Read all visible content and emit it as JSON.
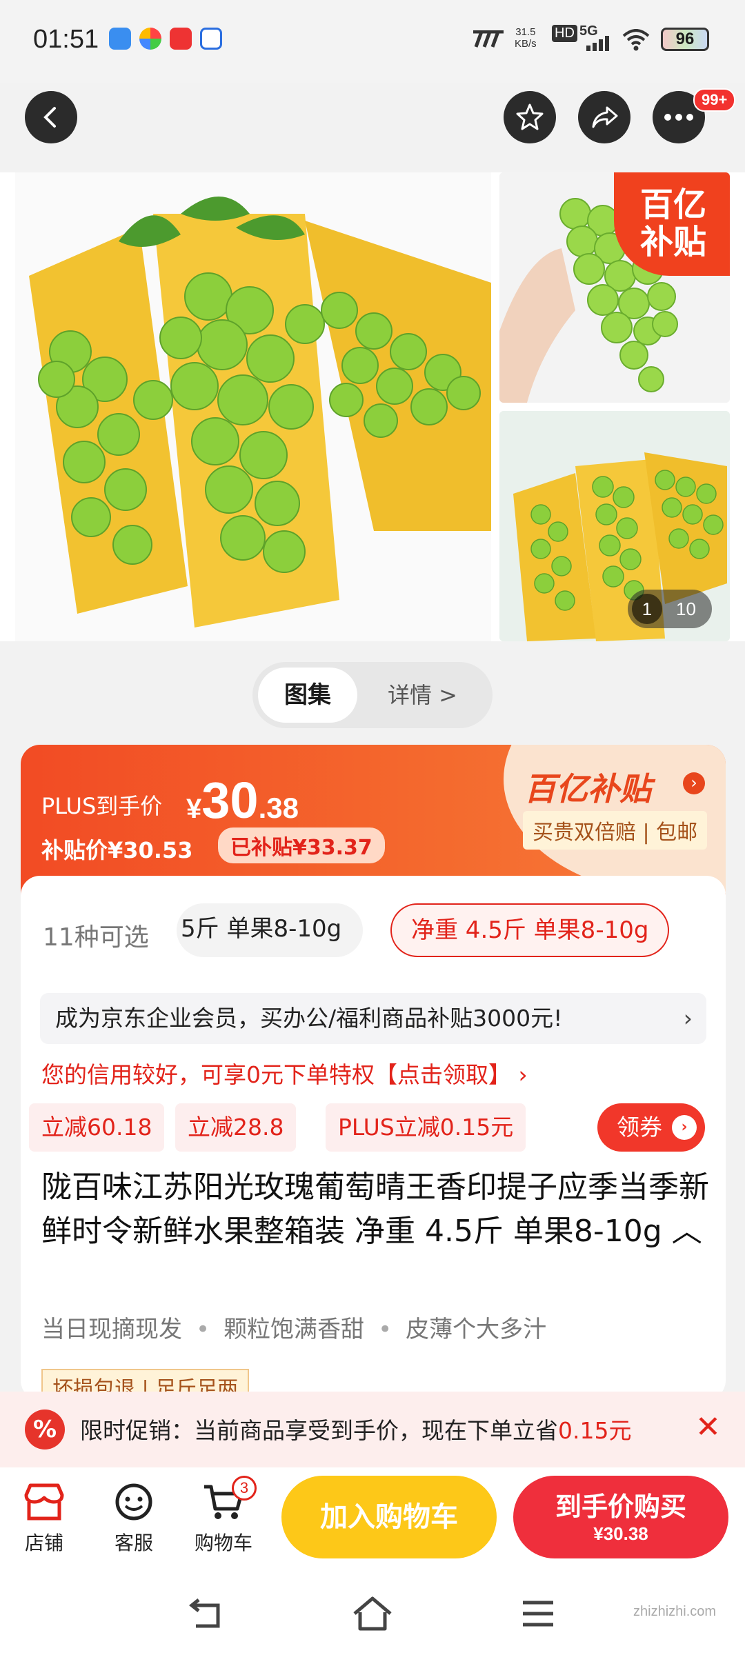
{
  "status_bar": {
    "time": "01:51",
    "net_speed_value": "31.5",
    "net_speed_unit": "KB/s",
    "hd_label": "HD",
    "signal_label": "5G",
    "battery": "96"
  },
  "nav": {
    "cart_badge_count": "99+"
  },
  "gallery": {
    "subsidy_tag_line1": "百亿",
    "subsidy_tag_line2": "补贴",
    "current_page": "1",
    "total_pages": "10"
  },
  "segment": {
    "gallery_tab": "图集",
    "detail_tab": "详情 >"
  },
  "price": {
    "plus_label": "PLUS到手价",
    "currency": "¥",
    "integer": "30",
    "decimal": ".38",
    "subsidy_price": "补贴价¥30.53",
    "already_subsidized": "已补贴¥33.37",
    "brand": "百亿补贴",
    "brand_note": "买贵双倍赔 | 包邮"
  },
  "options": {
    "count_label": "11种可选",
    "chip_partial": "5斤 单果8-10g",
    "chip_selected": "净重 4.5斤 单果8-10g"
  },
  "enterprise_banner": "成为京东企业会员，买办公/福利商品补贴3000元!",
  "credit_text": "您的信用较好，可享0元下单特权【点击领取】 ›",
  "coupons": [
    "立减60.18",
    "立减28.8",
    "PLUS立减0.15元"
  ],
  "get_coupon_label": "领券",
  "product_title": "陇百味江苏阳光玫瑰葡萄晴王香印提子应季当季新鲜时令新鲜水果整箱装 净重 4.5斤 单果8-10g ︿",
  "features": [
    "当日现摘现发",
    "颗粒饱满香甜",
    "皮薄个大多汁"
  ],
  "partial_tag": "坏损包退 | 足斤足两",
  "promo": {
    "icon_text": "%",
    "text_prefix": "限时促销：当前商品享受到手价，现在下单立省",
    "text_amount": "0.15元"
  },
  "bottom": {
    "store": "店铺",
    "service": "客服",
    "cart": "购物车",
    "cart_count": "3",
    "add_to_cart": "加入购物车",
    "buy_now": "到手价购买",
    "buy_now_price": "¥30.38"
  },
  "watermark": "zhizhizhi.com",
  "colors": {
    "accent_red": "#e2231a",
    "price_orange": "#f24b24",
    "cart_yellow": "#fdc818",
    "buy_red": "#ef2f3c"
  }
}
